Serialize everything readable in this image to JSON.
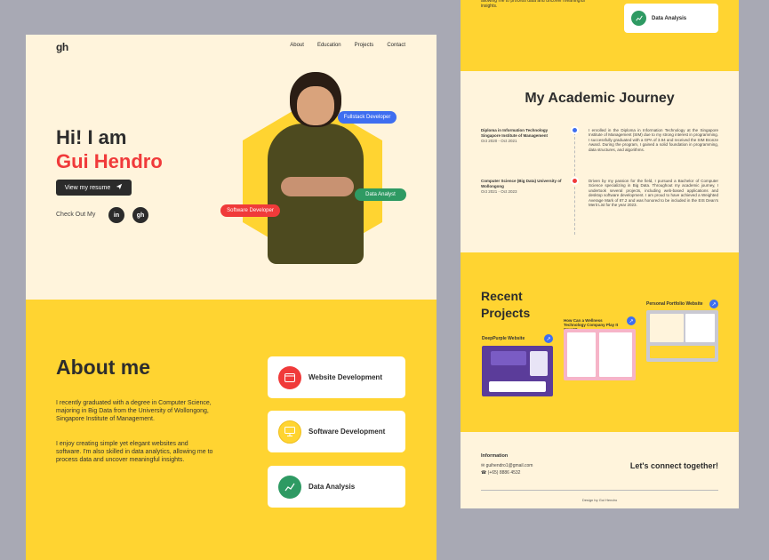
{
  "left": {
    "logo": "gh",
    "nav": [
      "About",
      "Education",
      "Projects",
      "Contact"
    ],
    "hero": {
      "greeting": "Hi! I am",
      "name": "Gui Hendro",
      "resume_label": "View my resume",
      "checkout_label": "Check Out My",
      "social": [
        {
          "name": "linkedin-icon",
          "glyph": "in"
        },
        {
          "name": "github-icon",
          "glyph": "gh"
        }
      ],
      "tags": {
        "fullstack": "Fullstack Developer",
        "data": "Data Analyst",
        "software": "Software Developer"
      },
      "colors": {
        "accent_red": "#f03a3a",
        "hex_yellow": "#ffd431",
        "tag_blue": "#3e6ef0",
        "tag_green": "#2e9a63"
      }
    },
    "about": {
      "title": "About me",
      "p1": "I recently graduated with a degree in Computer Science, majoring in Big Data from the University of Wollongong, Singapore Institute of Management.",
      "p2": "I enjoy creating simple yet elegant websites and software. I'm also skilled in data analytics, allowing me to process data and uncover meaningful insights.",
      "cards": [
        {
          "label": "Website Development",
          "color": "#f03a3a",
          "icon": "browser-icon"
        },
        {
          "label": "Software Development",
          "color": "#ffd431",
          "icon": "monitor-icon"
        },
        {
          "label": "Data Analysis",
          "color": "#2e9a63",
          "icon": "chart-icon"
        }
      ]
    }
  },
  "right": {
    "top_text": "allowing me to process data and uncover meaningful insights.",
    "top_card": "Data Analysis",
    "academic": {
      "title": "My Academic Journey",
      "items": [
        {
          "title": "Diploma in Information Technology Singapore Institute of Management",
          "date": "Oct 2020 - Oct 2021",
          "text": "I enrolled in the Diploma in Information Technology at the Singapore Institute of Management (SIM) due to my strong interest in programming. I successfully graduated with a GPA of 3.94 and received the SIM Bronze Award. During the program, I gained a solid foundation in programming, data structures, and algorithms.",
          "color": "#3e6ef0"
        },
        {
          "title": "Computer Science (Big Data) University of Wollongong",
          "date": "Oct 2021 - Oct 2023",
          "text": "Driven by my passion for the field, I pursued a Bachelor of Computer Science specializing in Big Data. Throughout my academic journey, I undertook several projects, including web-based applications and desktop software development. I am proud to have achieved a Weighted Average Mark of 87.2 and was honored to be included in the EIS Dean's Merit List for the year 2023.",
          "color": "#f03a3a"
        }
      ]
    },
    "projects": {
      "title": "Recent Projects",
      "items": [
        {
          "title": "DeepPurple Website"
        },
        {
          "title": "How Can a Wellness Technology Company Play It Smart?"
        },
        {
          "title": "Personal Portfolio Website"
        }
      ]
    },
    "footer": {
      "info_title": "Information",
      "email": "guihendro1@gmail.com",
      "phone": "(+65) 8886 4532",
      "connect": "Let's connect together!",
      "design_by": "Design by Gui Hendro"
    }
  }
}
